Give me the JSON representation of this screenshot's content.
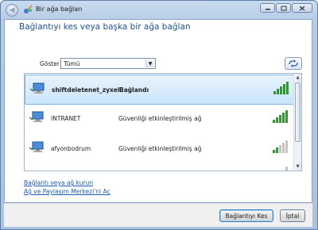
{
  "window": {
    "title": "Bir ağa bağlan",
    "caption_buttons": [
      "minimize",
      "maximize",
      "close"
    ]
  },
  "main": {
    "heading": "Bağlantıyı kes veya başka bir ağa bağlan",
    "filter_label": "Göster",
    "filter_value": "Tümü"
  },
  "networks": [
    {
      "name": "shiftdeletenet_zyxel",
      "status": "Bağlandı",
      "selected": true,
      "signal_bars": 5
    },
    {
      "name": "INTRANET",
      "status": "Güvenliği etkinleştirilmiş ağ",
      "selected": false,
      "signal_bars": 5
    },
    {
      "name": "afyonbodrum",
      "status": "Güvenliği etkinleştirilmiş ağ",
      "selected": false,
      "signal_bars": 2
    },
    {
      "name": "",
      "status": "",
      "selected": false,
      "signal_bars": 1
    }
  ],
  "links": {
    "setup": "Bağlantı veya ağ kurun",
    "network_center": "Ağ ve Paylaşım Merkezi'ni Aç"
  },
  "buttons": {
    "disconnect": "Bağlantıyı Kes",
    "cancel": "İptal"
  },
  "colors": {
    "heading": "#1d4f9b",
    "link": "#1a5bb9",
    "signal_on": "#2e9a2e",
    "signal_off": "#c4c4c4"
  }
}
